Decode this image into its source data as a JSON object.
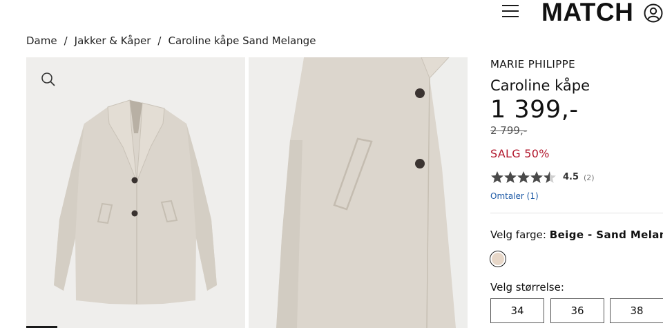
{
  "header": {
    "logo_text": "MATCH",
    "menu_icon": "hamburger-menu-icon",
    "account_icon": "user-account-icon"
  },
  "breadcrumb": {
    "items": [
      "Dame",
      "Jakker & Kåper",
      "Caroline kåpe Sand Melange"
    ],
    "separator": "/"
  },
  "gallery": {
    "zoom_icon": "magnifier-icon",
    "image_color": "#dcd7cf"
  },
  "product": {
    "brand": "MARIE PHILIPPE",
    "name": "Caroline kåpe",
    "price": "1 399,-",
    "old_price": "2 799,-",
    "sale_text": "SALG 50%",
    "rating": "4.5",
    "rating_value": 4.5,
    "rating_count": "(2)",
    "reviews_link": "Omtaler (1)",
    "color_label": "Velg farge:",
    "color_value": "Beige - Sand Melange",
    "swatch_color": "#e7d7c8",
    "size_label": "Velg størrelse:",
    "sizes": [
      "34",
      "36",
      "38"
    ],
    "sale_color": "#b1152b",
    "link_color": "#1d5aa6"
  }
}
